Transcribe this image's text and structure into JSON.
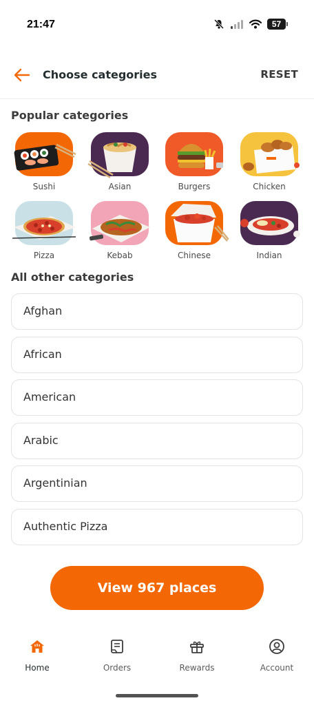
{
  "status_bar": {
    "time": "21:47",
    "battery": "57",
    "icons": [
      "mute-icon",
      "signal-icon",
      "wifi-icon",
      "battery-icon"
    ]
  },
  "header": {
    "back_icon": "arrow-left-icon",
    "title": "Choose categories",
    "reset_label": "RESET"
  },
  "popular": {
    "title": "Popular categories",
    "items": [
      {
        "label": "Sushi",
        "bg": "#f36805"
      },
      {
        "label": "Asian",
        "bg": "#4b2a52"
      },
      {
        "label": "Burgers",
        "bg": "#f05a28"
      },
      {
        "label": "Chicken",
        "bg": "#f6c33e"
      },
      {
        "label": "Pizza",
        "bg": "#c9e1e6"
      },
      {
        "label": "Kebab",
        "bg": "#f2a5b6"
      },
      {
        "label": "Chinese",
        "bg": "#f36805"
      },
      {
        "label": "Indian",
        "bg": "#4b2a52"
      }
    ]
  },
  "other": {
    "title": "All other categories",
    "items": [
      "Afghan",
      "African",
      "American",
      "Arabic",
      "Argentinian",
      "Authentic Pizza"
    ]
  },
  "cta": {
    "label": "View 967 places"
  },
  "tabs": [
    {
      "label": "Home",
      "icon": "home-icon",
      "active": true
    },
    {
      "label": "Orders",
      "icon": "receipt-icon",
      "active": false
    },
    {
      "label": "Rewards",
      "icon": "gift-icon",
      "active": false
    },
    {
      "label": "Account",
      "icon": "account-icon",
      "active": false
    }
  ],
  "colors": {
    "accent": "#f36805",
    "text": "#242e30"
  }
}
